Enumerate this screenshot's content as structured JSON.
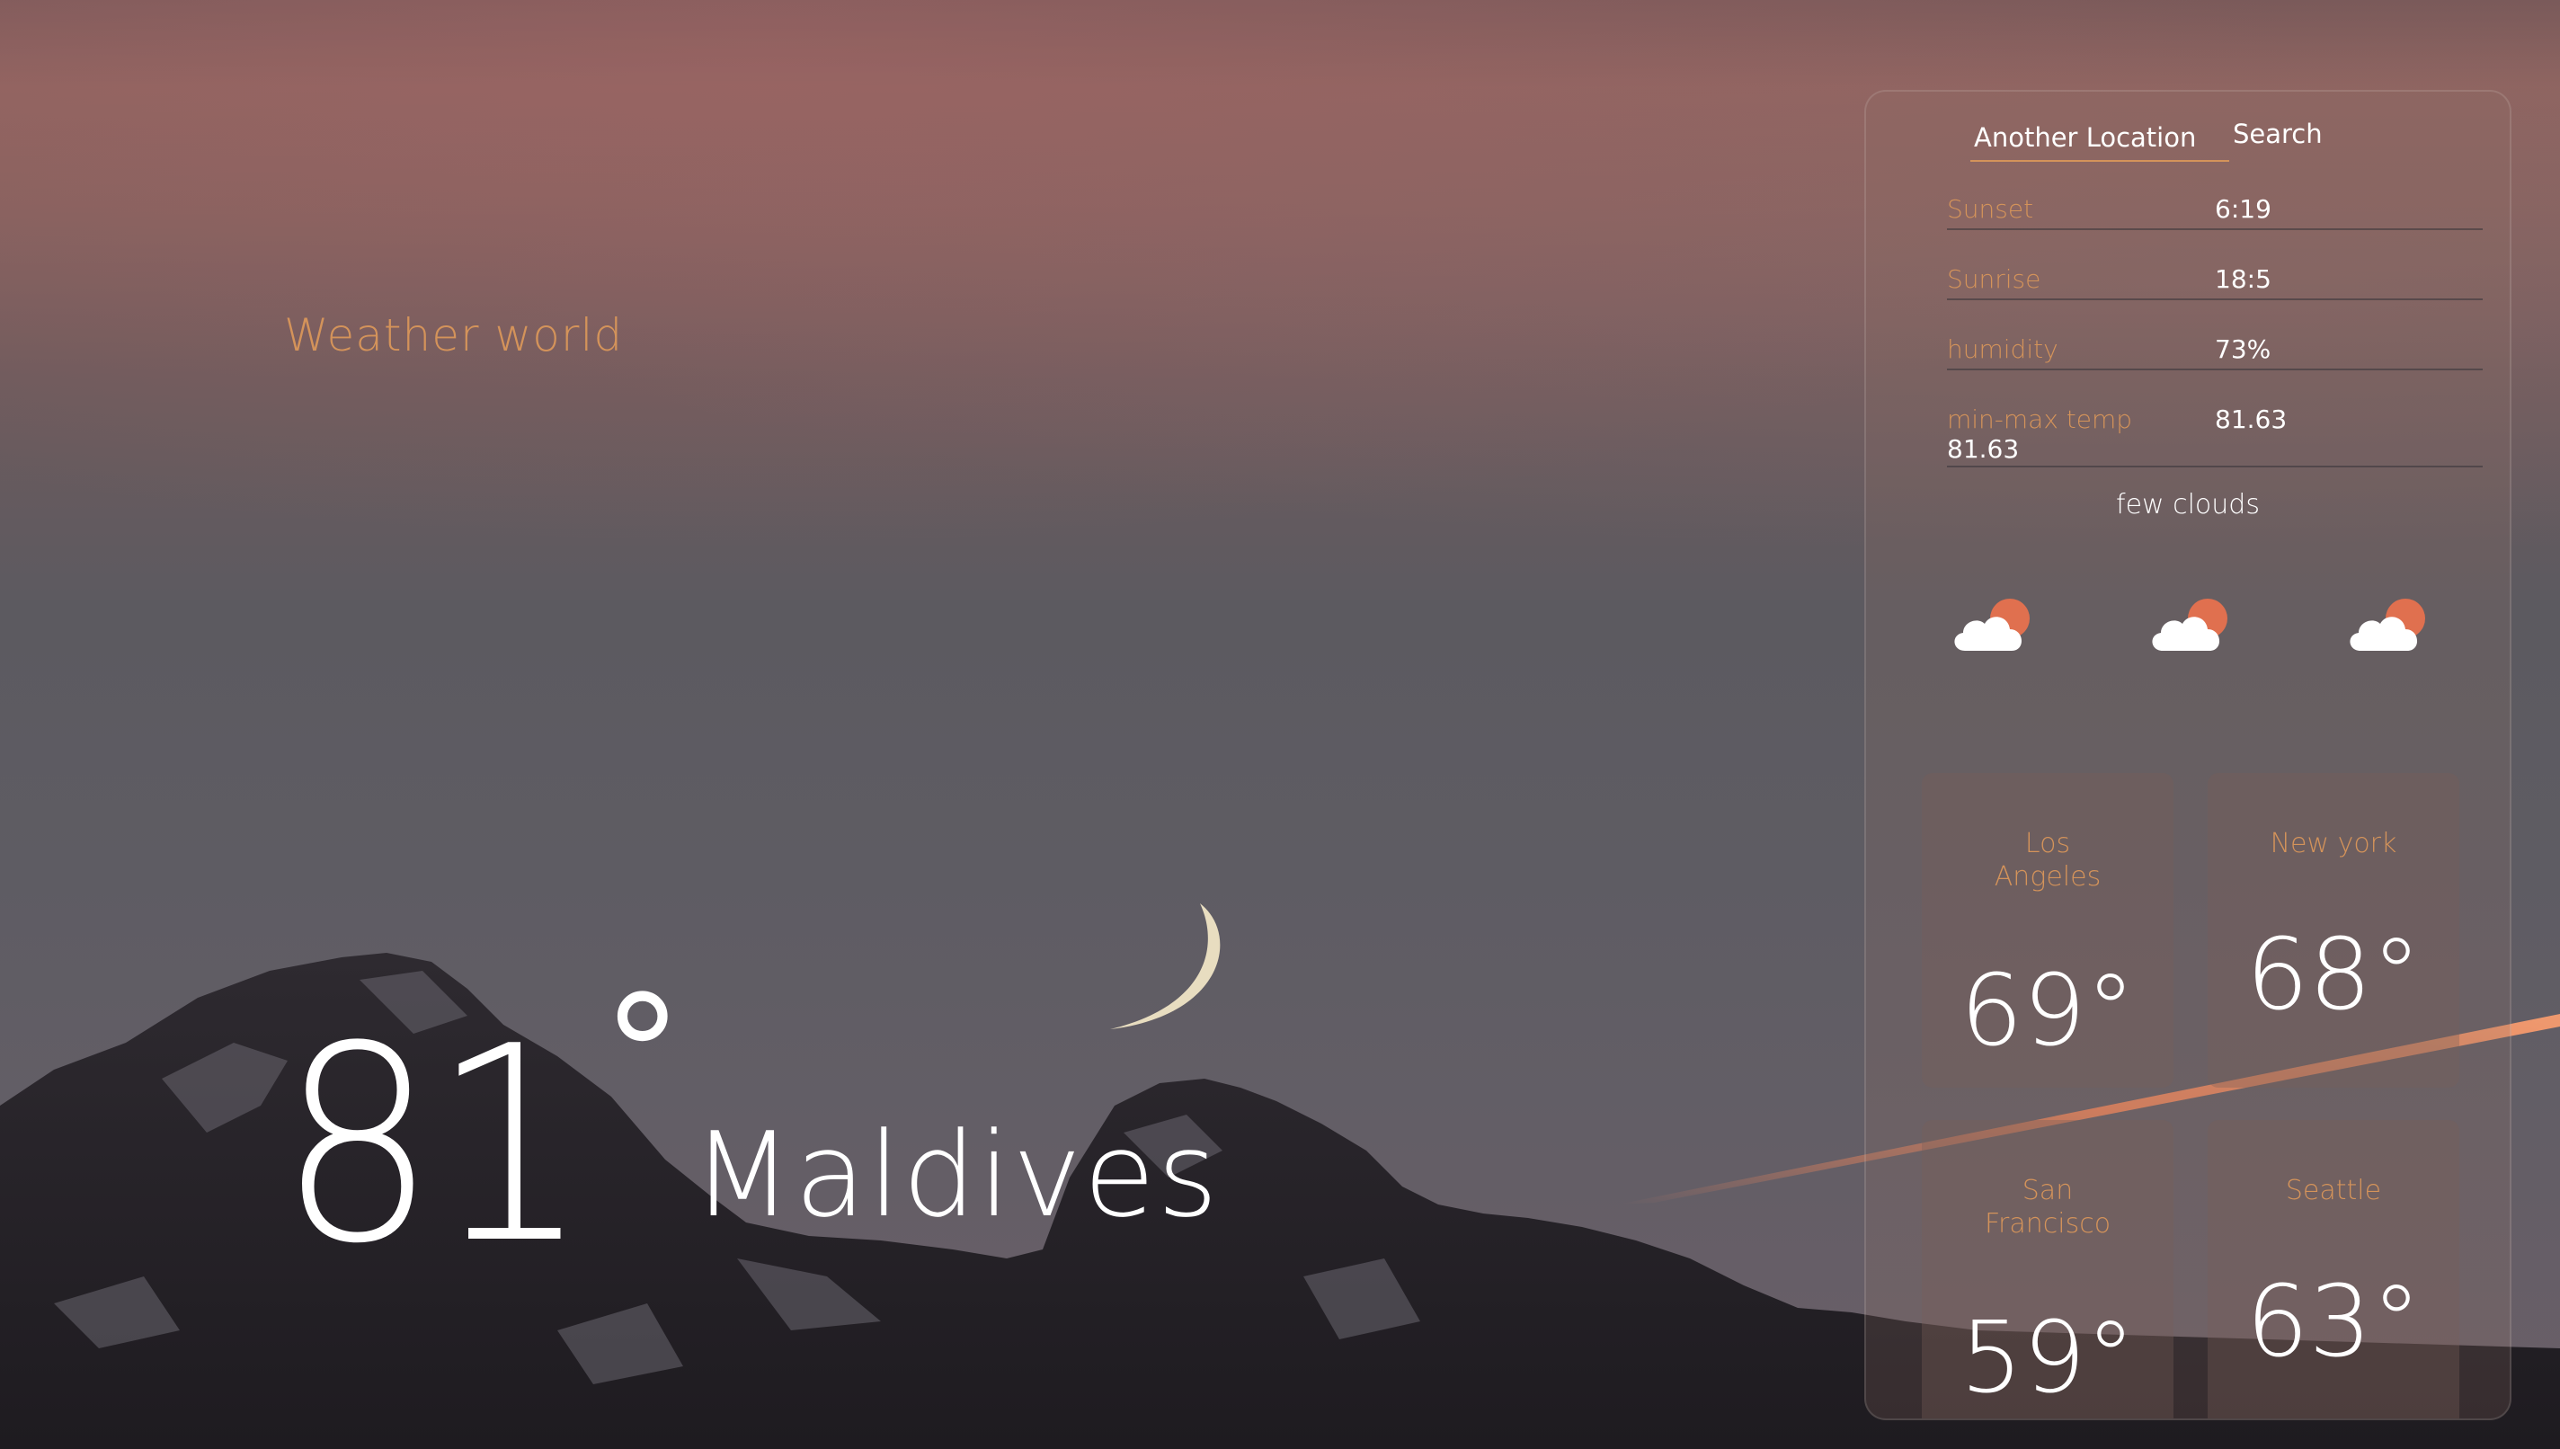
{
  "app": {
    "brand": "Weather world"
  },
  "current": {
    "temp": "81",
    "degree": "°",
    "city": "Maldives"
  },
  "search": {
    "placeholder": "Another Location",
    "button_label": "Search"
  },
  "details": [
    {
      "label": "Sunset",
      "value": "6:19",
      "value2": ""
    },
    {
      "label": "Sunrise",
      "value": "18:5",
      "value2": ""
    },
    {
      "label": "humidity",
      "value": "73%",
      "value2": ""
    },
    {
      "label": "min-max temp",
      "value": "81.63",
      "value2": "81.63"
    }
  ],
  "condition": "few clouds",
  "forecast_icons": [
    "partly-cloudy-icon",
    "partly-cloudy-icon",
    "partly-cloudy-icon"
  ],
  "cities": [
    {
      "name": "Los Angeles",
      "temp": "69°"
    },
    {
      "name": "New york",
      "temp": "68°"
    },
    {
      "name": "San Francisco",
      "temp": "59°"
    },
    {
      "name": "Seattle",
      "temp": "63°"
    }
  ],
  "colors": {
    "accent": "#d4935a",
    "text": "#ffffff",
    "sun": "#e0704f"
  }
}
